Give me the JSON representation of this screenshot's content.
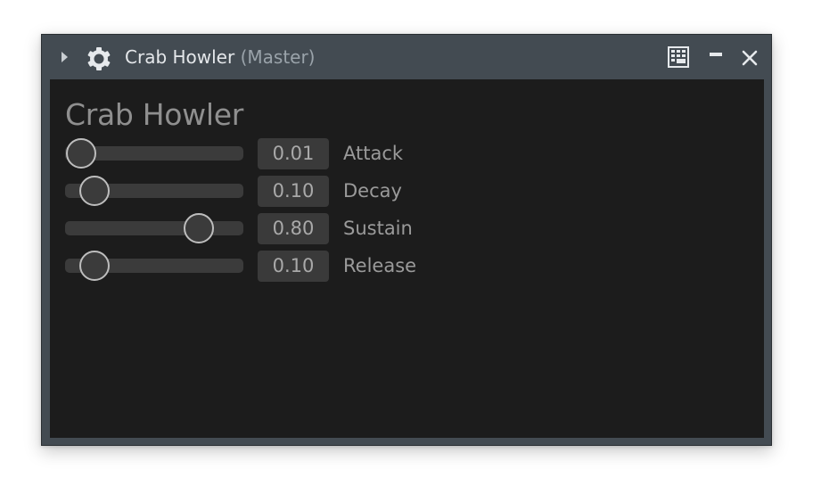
{
  "window": {
    "title": "Crab Howler",
    "subtitle": "(Master)",
    "icons": {
      "expand": "triangle-right-icon",
      "plugin": "gear-icon",
      "grid": "keypad-grid-icon",
      "minimize": "minimize-icon",
      "close": "close-icon"
    }
  },
  "panel": {
    "heading": "Crab Howler",
    "params": [
      {
        "label": "Attack",
        "value": "0.01",
        "fraction": 0.01
      },
      {
        "label": "Decay",
        "value": "0.10",
        "fraction": 0.1
      },
      {
        "label": "Sustain",
        "value": "0.80",
        "fraction": 0.8
      },
      {
        "label": "Release",
        "value": "0.10",
        "fraction": 0.1
      }
    ]
  },
  "colors": {
    "frame": "#434b52",
    "panel_bg": "#1c1c1c",
    "track": "#3b3b3b",
    "knob_border": "#bdbdbd",
    "text_dim": "#9a9a9a"
  }
}
